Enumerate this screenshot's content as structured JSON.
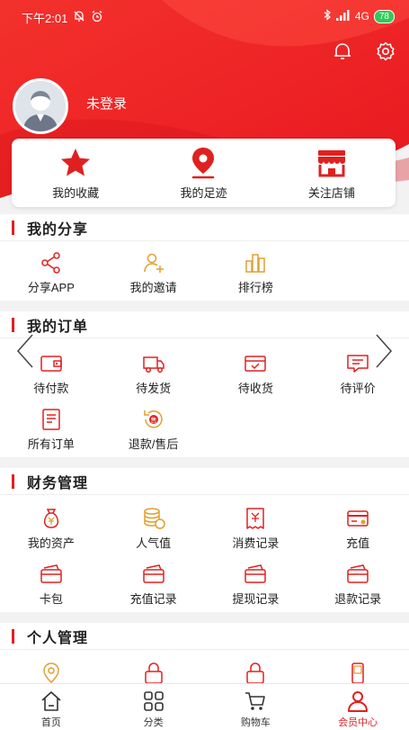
{
  "status_bar": {
    "time": "下午2:01",
    "network": "4G",
    "battery": "78"
  },
  "header": {
    "login_label": "未登录"
  },
  "favorites": [
    {
      "label": "我的收藏",
      "icon": "star-icon"
    },
    {
      "label": "我的足迹",
      "icon": "location-pin-icon"
    },
    {
      "label": "关注店铺",
      "icon": "store-icon"
    }
  ],
  "share": {
    "title": "我的分享",
    "items": [
      {
        "label": "分享APP",
        "icon": "share-icon"
      },
      {
        "label": "我的邀请",
        "icon": "invite-user-icon"
      },
      {
        "label": "排行榜",
        "icon": "ranking-icon"
      }
    ]
  },
  "orders": {
    "title": "我的订单",
    "items": [
      {
        "label": "待付款",
        "icon": "wallet-icon"
      },
      {
        "label": "待发货",
        "icon": "truck-icon"
      },
      {
        "label": "待收货",
        "icon": "receive-box-icon"
      },
      {
        "label": "待评价",
        "icon": "comment-icon"
      },
      {
        "label": "所有订单",
        "icon": "order-list-icon"
      },
      {
        "label": "退款/售后",
        "icon": "refund-icon"
      }
    ]
  },
  "finance": {
    "title": "财务管理",
    "items": [
      {
        "label": "我的资产",
        "icon": "money-bag-icon"
      },
      {
        "label": "人气值",
        "icon": "coins-icon"
      },
      {
        "label": "消费记录",
        "icon": "receipt-icon"
      },
      {
        "label": "充值",
        "icon": "card-icon"
      },
      {
        "label": "卡包",
        "icon": "card-wallet-icon"
      },
      {
        "label": "充值记录",
        "icon": "card-wallet-icon"
      },
      {
        "label": "提现记录",
        "icon": "card-wallet-icon"
      },
      {
        "label": "退款记录",
        "icon": "card-wallet-icon"
      }
    ]
  },
  "personal": {
    "title": "个人管理"
  },
  "tabbar": {
    "items": [
      {
        "label": "首页",
        "icon": "home-icon"
      },
      {
        "label": "分类",
        "icon": "category-grid-icon"
      },
      {
        "label": "购物车",
        "icon": "cart-icon"
      },
      {
        "label": "会员中心",
        "icon": "user-icon"
      }
    ],
    "active_index": 3
  },
  "colors": {
    "brand": "#e02020",
    "gold": "#e0a030"
  }
}
